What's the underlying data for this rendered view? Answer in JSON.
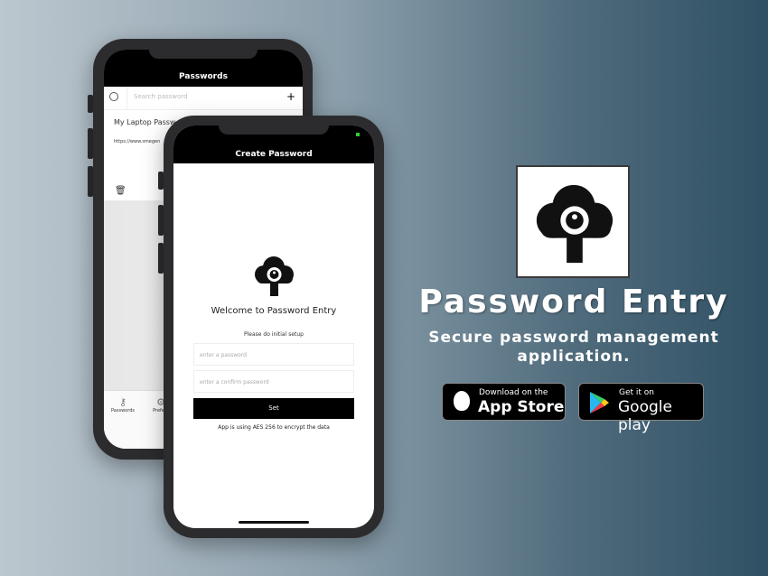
{
  "back_phone": {
    "title": "Passwords",
    "search_placeholder": "Search password",
    "add": "+",
    "item_title": "My Laptop Passw",
    "item_url": "https://www.smegen",
    "tabs": [
      {
        "label": "Passwords",
        "icon": "key-icon"
      },
      {
        "label": "Prefere",
        "icon": "gear-icon"
      }
    ]
  },
  "front_phone": {
    "title": "Create Password",
    "welcome": "Welcome to Password Entry",
    "setup": "Please do initial setup",
    "password_placeholder": "enter a password",
    "confirm_placeholder": "enter a confirm password",
    "set_label": "Set",
    "footer": "App is using AES 256 to encrypt the data"
  },
  "promo": {
    "app_name": "Password Entry",
    "tagline_1": "Secure password management",
    "tagline_2": "application.",
    "app_store": {
      "small": "Download on the",
      "big": "App Store"
    },
    "google_play": {
      "small": "Get it on",
      "big": "Google play"
    }
  }
}
